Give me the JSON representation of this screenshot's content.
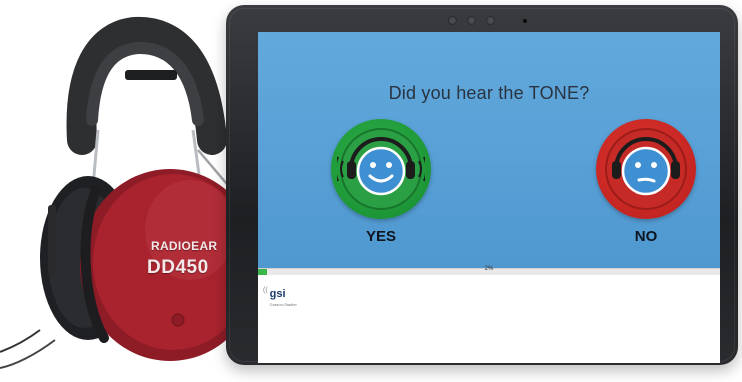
{
  "headphones": {
    "brand": "RADIOEAR",
    "model": "DD450"
  },
  "screen": {
    "question": "Did you hear the TONE?",
    "yes_label": "YES",
    "no_label": "NO",
    "progress_text": "2%",
    "progress_fraction": 0.02,
    "footer_logo": "gsi",
    "footer_logo_sub": "Grason-Stadler"
  },
  "icons": {
    "yes_button": "smiling-face-with-headphones-icon",
    "no_button": "neutral-face-with-headphones-icon",
    "footer": "gsi-logo"
  },
  "colors": {
    "screen_background": "#62a9dc",
    "yes_button": "#1f9c3a",
    "no_button": "#cc2a26",
    "face": "#3f8fd3",
    "progress_fill": "#3cb54a",
    "headphone_cup": "#a8232e"
  }
}
